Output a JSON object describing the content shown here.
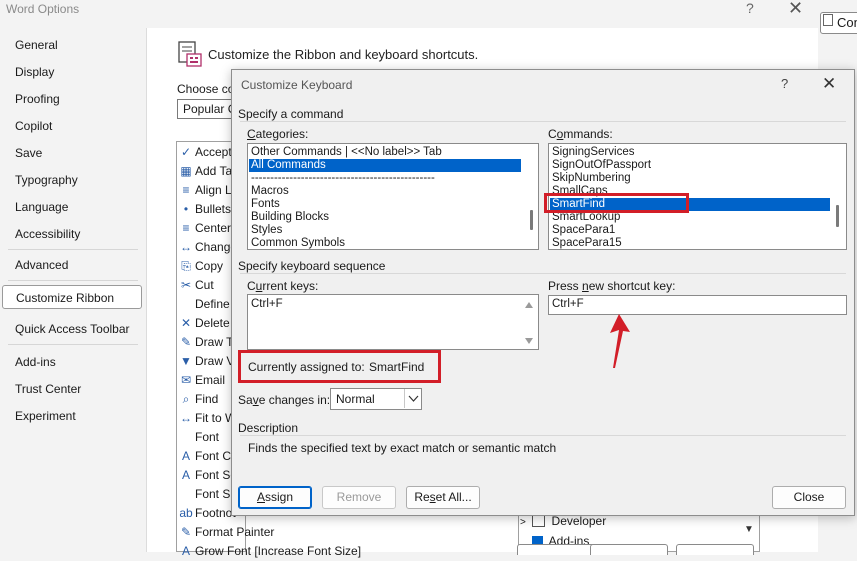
{
  "word_options": {
    "title": "Word Options",
    "help_glyph": "?",
    "close_glyph": "✕",
    "sidebar": [
      {
        "label": "General"
      },
      {
        "label": "Display"
      },
      {
        "label": "Proofing"
      },
      {
        "label": "Copilot"
      },
      {
        "label": "Save"
      },
      {
        "label": "Typography"
      },
      {
        "label": "Language"
      },
      {
        "label": "Accessibility"
      },
      {
        "label": "Advanced"
      },
      {
        "label": "Customize Ribbon",
        "active": true
      },
      {
        "label": "Quick Access Toolbar"
      },
      {
        "label": "Add-ins"
      },
      {
        "label": "Trust Center"
      },
      {
        "label": "Experiment"
      }
    ],
    "heading": "Customize the Ribbon and keyboard shortcuts.",
    "choose_label": "Choose co",
    "choose_value": "Popular C",
    "commands_list": [
      {
        "icon": "✓",
        "label": "Accept"
      },
      {
        "icon": "▦",
        "label": "Add Ta"
      },
      {
        "icon": "≡",
        "label": "Align L"
      },
      {
        "icon": "•",
        "label": "Bullets"
      },
      {
        "icon": "≡",
        "label": "Center"
      },
      {
        "icon": "↔",
        "label": "Change"
      },
      {
        "icon": "⎘",
        "label": "Copy"
      },
      {
        "icon": "✂",
        "label": "Cut"
      },
      {
        "icon": "",
        "label": "Define"
      },
      {
        "icon": "✕",
        "label": "Delete"
      },
      {
        "icon": "✎",
        "label": "Draw Ta"
      },
      {
        "icon": "▼",
        "label": "Draw V"
      },
      {
        "icon": "✉",
        "label": "Email"
      },
      {
        "icon": "⌕",
        "label": "Find"
      },
      {
        "icon": "↔",
        "label": "Fit to W"
      },
      {
        "icon": "",
        "label": "Font"
      },
      {
        "icon": "A",
        "label": "Font Co"
      },
      {
        "icon": "A",
        "label": "Font Se"
      },
      {
        "icon": "",
        "label": "Font Si"
      },
      {
        "icon": "ab",
        "label": "Footnot"
      },
      {
        "icon": "✎",
        "label": "Format Painter"
      },
      {
        "icon": "A",
        "label": "Grow Font [Increase Font Size]"
      }
    ],
    "con_label": "Con",
    "tree": {
      "item1": "Developer",
      "item2": "Add-ins"
    }
  },
  "dialog": {
    "title": "Customize Keyboard",
    "help_glyph": "?",
    "close_glyph": "✕",
    "specify_command": "Specify a command",
    "categories_label": "Categories:",
    "categories": [
      {
        "label": "Other Commands | <<No label>> Tab"
      },
      {
        "label": "All Commands",
        "selected": true
      },
      {
        "label": "------------------------------------------------"
      },
      {
        "label": "Macros"
      },
      {
        "label": "Fonts"
      },
      {
        "label": "Building Blocks"
      },
      {
        "label": "Styles"
      },
      {
        "label": "Common Symbols"
      }
    ],
    "commands_label": "Commands:",
    "commands": [
      {
        "label": "SigningServices"
      },
      {
        "label": "SignOutOfPassport"
      },
      {
        "label": "SkipNumbering"
      },
      {
        "label": "SmallCaps"
      },
      {
        "label": "SmartFind",
        "selected": true
      },
      {
        "label": "SmartLookup"
      },
      {
        "label": "SpacePara1"
      },
      {
        "label": "SpacePara15"
      }
    ],
    "specify_sequence": "Specify keyboard sequence",
    "current_keys_label": "Current keys:",
    "current_keys": "Ctrl+F",
    "new_shortcut_label": "Press new shortcut key:",
    "new_shortcut_value": "Ctrl+F",
    "assigned_label": "Currently assigned to:",
    "assigned_value": "SmartFind",
    "save_changes_label": "Save changes in:",
    "save_changes_value": "Normal",
    "description_header": "Description",
    "description_text": "Finds the specified text by exact match or semantic match",
    "buttons": {
      "assign": "Assign",
      "remove": "Remove",
      "reset_all": "Reset All...",
      "close": "Close"
    }
  },
  "colors": {
    "selection": "#0063c9",
    "annotation_red": "#d21e28"
  }
}
